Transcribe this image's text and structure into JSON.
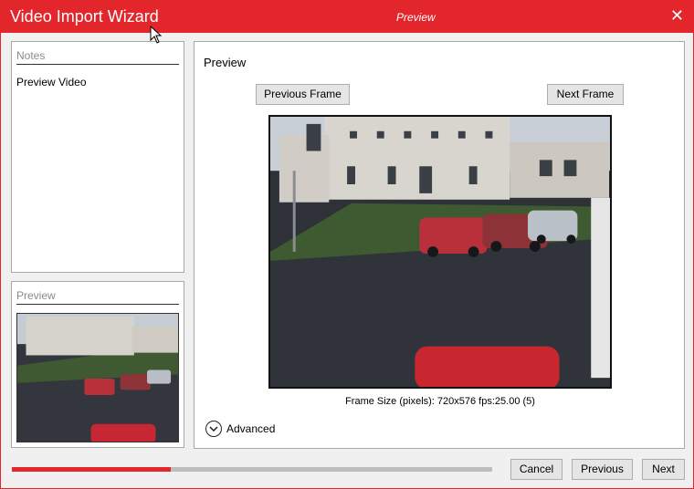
{
  "window": {
    "title": "Video Import Wizard",
    "subtitle": "Preview",
    "close_glyph": "✕",
    "accent_color": "#e3262b"
  },
  "notes": {
    "header": "Notes",
    "text": "Preview Video"
  },
  "preview_small": {
    "header": "Preview"
  },
  "main": {
    "title": "Preview",
    "previous_frame_label": "Previous Frame",
    "next_frame_label": "Next Frame",
    "frame_info": "Frame Size (pixels):  720x576 fps:25.00 (5)",
    "advanced_label": "Advanced",
    "advanced_icon": "chevron-down-circle-icon"
  },
  "progress": {
    "fraction": 0.33
  },
  "footer": {
    "cancel_label": "Cancel",
    "previous_label": "Previous",
    "next_label": "Next"
  }
}
